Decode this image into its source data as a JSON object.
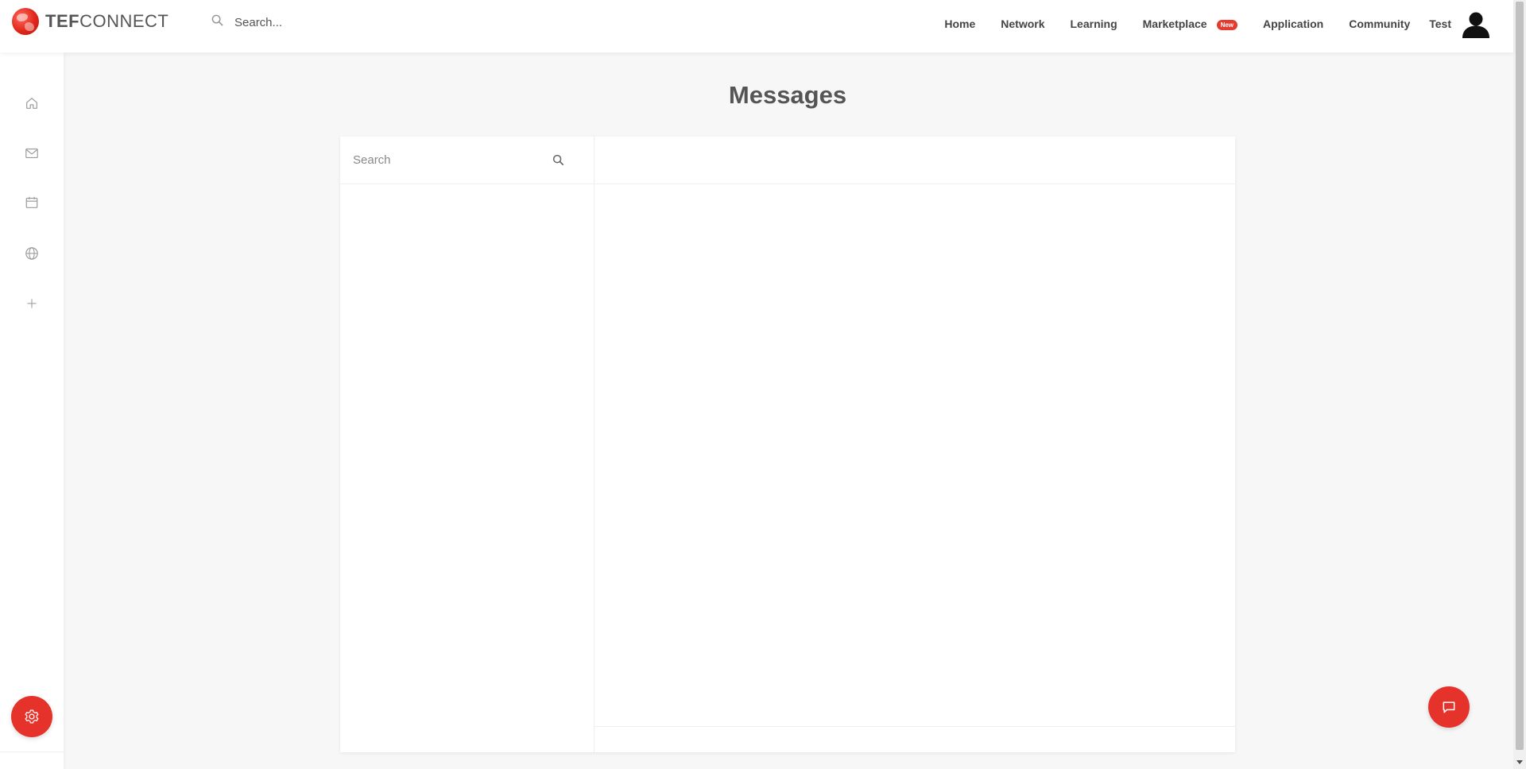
{
  "app": {
    "logo_bold": "TEF",
    "logo_light": "CONNECT"
  },
  "topbar": {
    "search_placeholder": "Search...",
    "nav": [
      {
        "label": "Home"
      },
      {
        "label": "Network"
      },
      {
        "label": "Learning"
      },
      {
        "label": "Marketplace",
        "badge": "New"
      },
      {
        "label": "Application"
      },
      {
        "label": "Community"
      }
    ],
    "user_name": "Test"
  },
  "sidebar": {
    "icons": [
      "home-icon",
      "mail-icon",
      "calendar-icon",
      "globe-icon",
      "plus-icon"
    ],
    "settings_icon": "gear-icon"
  },
  "main": {
    "title": "Messages",
    "conversation_search_placeholder": "Search"
  },
  "colors": {
    "accent": "#e5322b",
    "badge": "#e53a2e",
    "background": "#f7f7f7"
  }
}
